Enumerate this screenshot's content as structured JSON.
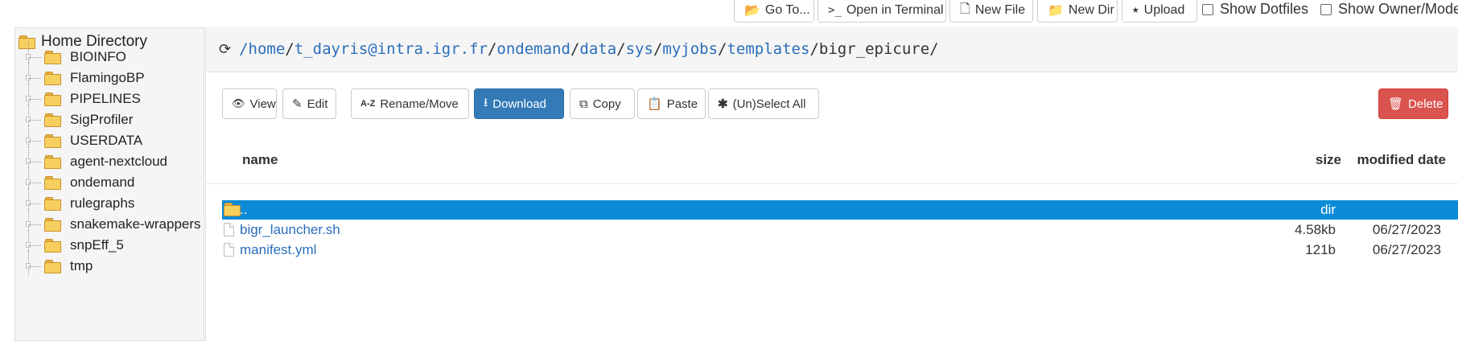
{
  "toolbar": {
    "goto_label": "Go To...",
    "terminal_label": "Open in Terminal",
    "newfile_label": "New File",
    "newdir_label": "New Dir",
    "upload_label": "Upload",
    "show_dotfiles_label": "Show Dotfiles",
    "show_owner_label": "Show Owner/Mode"
  },
  "tree": {
    "root_label": "Home Directory",
    "items": [
      {
        "label": "BIOINFO"
      },
      {
        "label": "FlamingoBP"
      },
      {
        "label": "PIPELINES"
      },
      {
        "label": "SigProfiler"
      },
      {
        "label": "USERDATA"
      },
      {
        "label": "agent-nextcloud"
      },
      {
        "label": "ondemand"
      },
      {
        "label": "rulegraphs"
      },
      {
        "label": "snakemake-wrappers"
      },
      {
        "label": "snpEff_5"
      },
      {
        "label": "tmp"
      }
    ]
  },
  "path": {
    "segments": [
      "/home",
      "t_dayris@intra.igr.fr",
      "ondemand",
      "data",
      "sys",
      "myjobs",
      "templates"
    ],
    "current": "bigr_epicure/",
    "sep": "/"
  },
  "actions": {
    "view": "View",
    "edit": "Edit",
    "rename": "Rename/Move",
    "download": "Download",
    "copy": "Copy",
    "paste": "Paste",
    "select_all": "(Un)Select All",
    "delete": "Delete"
  },
  "table": {
    "headers": {
      "name": "name",
      "size": "size",
      "modified": "modified date"
    },
    "rows": [
      {
        "name": "..",
        "size": "dir",
        "date": ""
      },
      {
        "name": "bigr_launcher.sh",
        "size": "4.58kb",
        "date": "06/27/2023"
      },
      {
        "name": "manifest.yml",
        "size": "121b",
        "date": "06/27/2023"
      }
    ]
  },
  "colors": {
    "primary": "#337ab7",
    "danger": "#d9534f",
    "selected_row": "#0b8bd6",
    "link": "#2a6ebb"
  }
}
